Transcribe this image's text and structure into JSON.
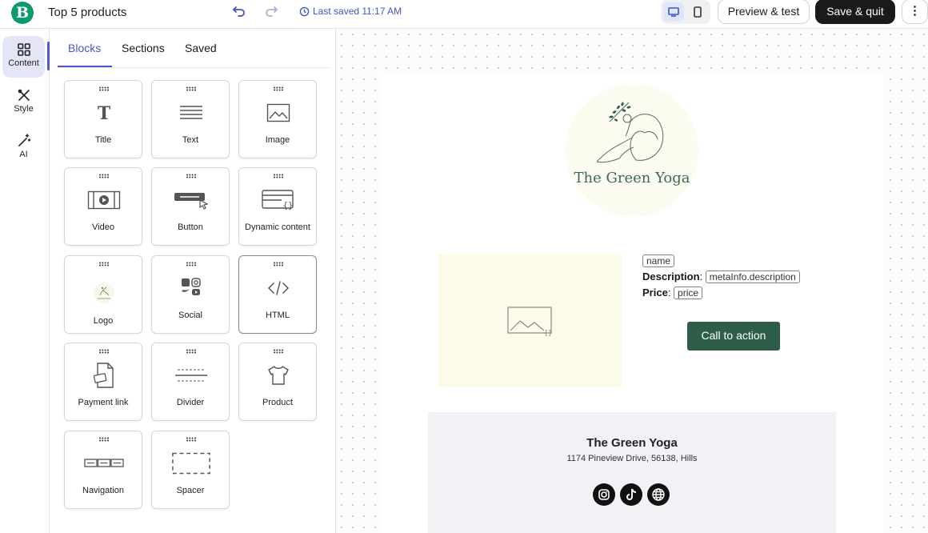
{
  "app": {
    "logo_letter": "B",
    "title": "Top 5 products",
    "saved_status": "Last saved 11:17 AM"
  },
  "toolbar": {
    "preview_label": "Preview & test",
    "save_label": "Save & quit",
    "more_label": "⋮"
  },
  "rail": {
    "items": [
      {
        "label": "Content",
        "icon": "grid-icon"
      },
      {
        "label": "Style",
        "icon": "brush-icon"
      },
      {
        "label": "AI",
        "icon": "magic-wand-icon"
      }
    ]
  },
  "panel": {
    "tabs": [
      "Blocks",
      "Sections",
      "Saved"
    ],
    "blocks": [
      {
        "label": "Title",
        "icon": "title-icon"
      },
      {
        "label": "Text",
        "icon": "text-icon"
      },
      {
        "label": "Image",
        "icon": "image-icon"
      },
      {
        "label": "Video",
        "icon": "video-icon"
      },
      {
        "label": "Button",
        "icon": "button-icon"
      },
      {
        "label": "Dynamic content",
        "icon": "dynamic-content-icon"
      },
      {
        "label": "Logo",
        "icon": "logo-icon"
      },
      {
        "label": "Social",
        "icon": "social-icon"
      },
      {
        "label": "HTML",
        "icon": "html-icon"
      },
      {
        "label": "Payment link",
        "icon": "payment-link-icon"
      },
      {
        "label": "Divider",
        "icon": "divider-icon"
      },
      {
        "label": "Product",
        "icon": "product-icon"
      },
      {
        "label": "Navigation",
        "icon": "navigation-icon"
      },
      {
        "label": "Spacer",
        "icon": "spacer-icon"
      }
    ]
  },
  "email": {
    "brand_name": "The Green Yoga",
    "product": {
      "name_tag": "name",
      "description_label": "Description",
      "description_tag": "metaInfo.description",
      "price_label": "Price",
      "price_tag": "price"
    },
    "cta_label": "Call to action",
    "footer": {
      "name": "The Green Yoga",
      "address": "1174 Pineview Drive, 56138, Hills"
    }
  },
  "colors": {
    "accent": "#4957c9",
    "brand_green": "#2e5e48",
    "save_button": "#1a1a1a"
  }
}
